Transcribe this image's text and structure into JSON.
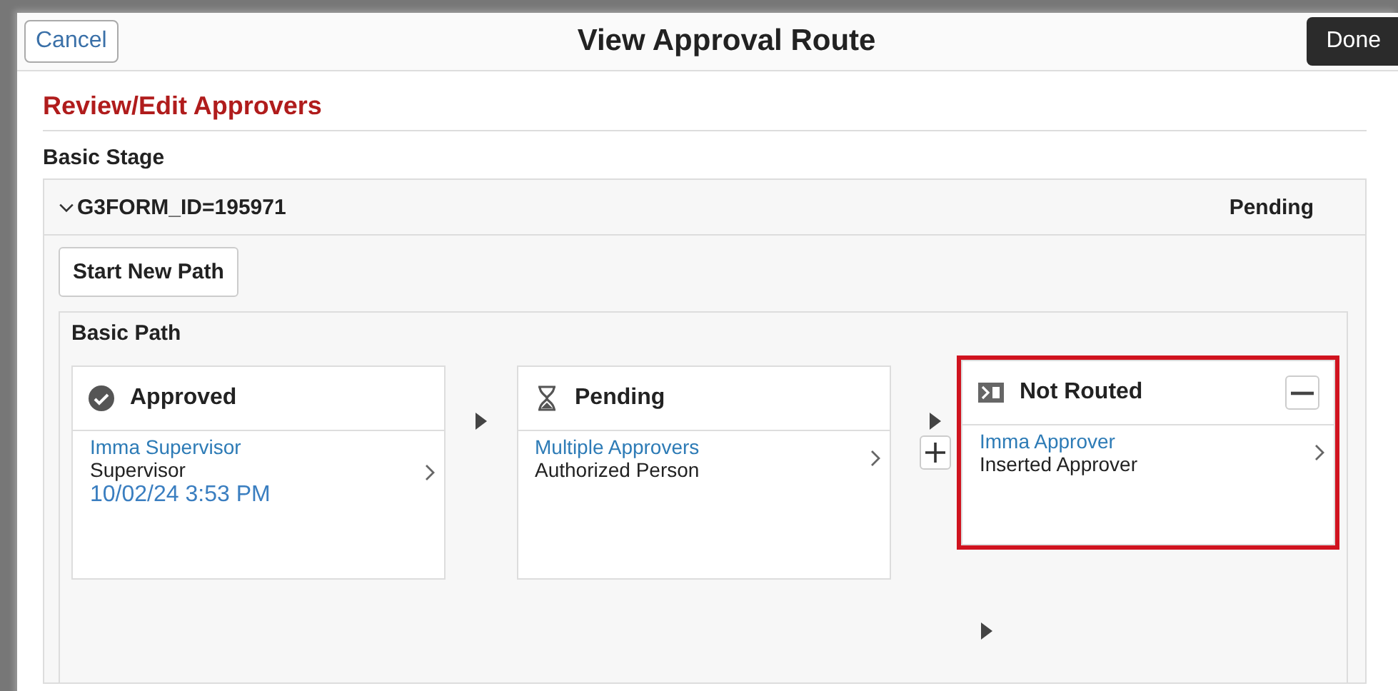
{
  "header": {
    "cancel": "Cancel",
    "title": "View Approval Route",
    "done": "Done"
  },
  "section_title": "Review/Edit Approvers",
  "stage": {
    "label": "Basic Stage",
    "id": "G3FORM_ID=195971",
    "expanded": true,
    "status": "Pending",
    "start_new_path": "Start New Path",
    "path": {
      "label": "Basic Path",
      "steps": [
        {
          "kind": "approved",
          "status": "Approved",
          "name": "Imma Supervisor",
          "role": "Supervisor",
          "date": "10/02/24 3:53 PM",
          "highlighted": false,
          "removable": false,
          "addable": false
        },
        {
          "kind": "pending",
          "status": "Pending",
          "name": "Multiple Approvers",
          "role": "Authorized Person",
          "highlighted": false,
          "removable": false,
          "addable": true
        },
        {
          "kind": "not_routed",
          "status": "Not Routed",
          "name": "Imma Approver",
          "role": "Inserted Approver",
          "highlighted": true,
          "removable": true,
          "addable": false
        }
      ]
    }
  }
}
